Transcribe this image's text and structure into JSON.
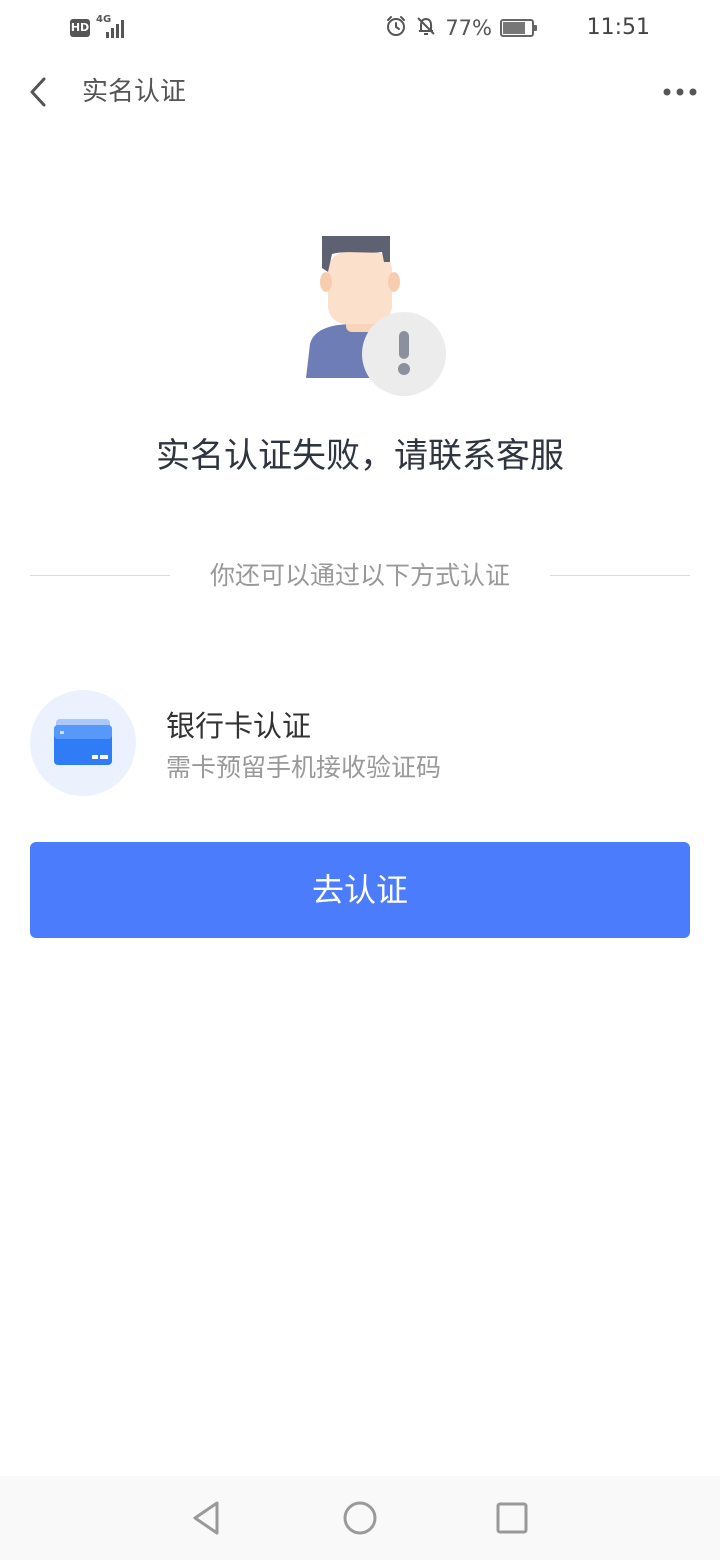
{
  "status_bar": {
    "hd_badge": "HD",
    "network_type": "4G",
    "battery_text": "77%",
    "battery_level": 0.77,
    "time": "11:51",
    "icons": [
      "alarm-icon",
      "mute-icon",
      "battery-icon"
    ]
  },
  "header": {
    "title": "实名认证",
    "back_icon": "back-arrow-icon",
    "more_icon": "more-dots-icon"
  },
  "result": {
    "illustration": "user-alert-illustration",
    "message": "实名认证失败，请联系客服"
  },
  "alternatives": {
    "divider_text": "你还可以通过以下方式认证"
  },
  "option": {
    "icon": "bank-card-icon",
    "title": "银行卡认证",
    "description": "需卡预留手机接收验证码"
  },
  "action": {
    "button_label": "去认证"
  },
  "colors": {
    "primary": "#4b7cfc",
    "icon_bg": "#ebf2fd",
    "text_dark": "#2f3540",
    "text_gray": "#999999"
  },
  "nav_bar": {
    "icons": [
      "nav-back-icon",
      "nav-home-icon",
      "nav-recents-icon"
    ]
  }
}
